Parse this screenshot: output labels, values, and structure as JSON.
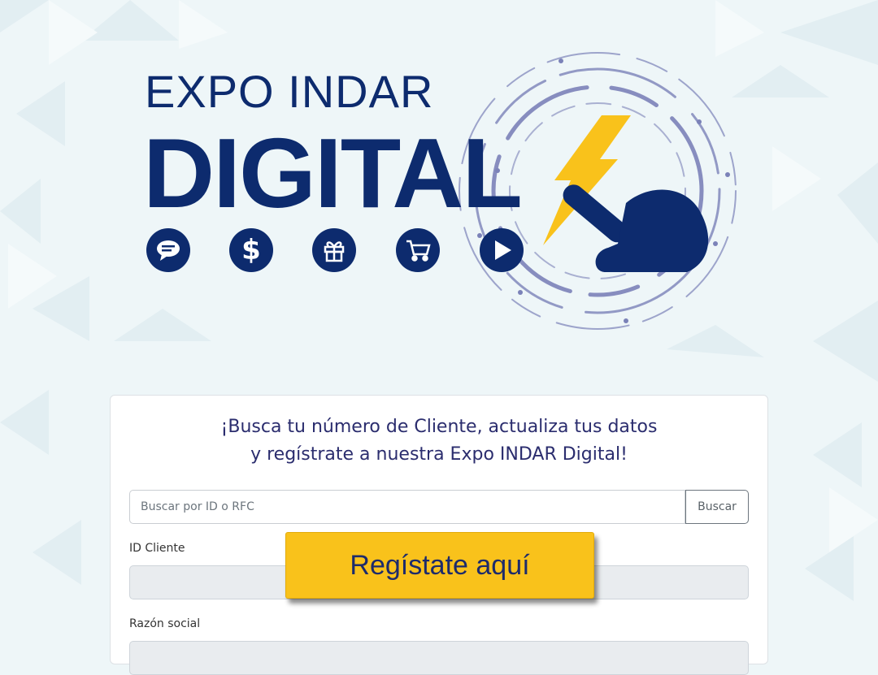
{
  "logo": {
    "title_top": "EXPO INDAR",
    "title_main": "DIGITAL",
    "icons": [
      "chat-icon",
      "dollar-icon",
      "gift-icon",
      "cart-icon",
      "play-icon"
    ],
    "brand_color": "#0d2b6e",
    "accent_color": "#f9c21b"
  },
  "card": {
    "headline_line1": "¡Busca tu número de Cliente, actualiza tus datos",
    "headline_line2": "y regístrate a nuestra Expo INDAR Digital!",
    "search": {
      "placeholder": "Buscar por ID o RFC",
      "button_label": "Buscar"
    },
    "fields": {
      "id_cliente_label": "ID Cliente",
      "razon_social_label": "Razón social"
    }
  },
  "cta": {
    "label": "Regístate aquí",
    "color": "#f9c21b"
  }
}
